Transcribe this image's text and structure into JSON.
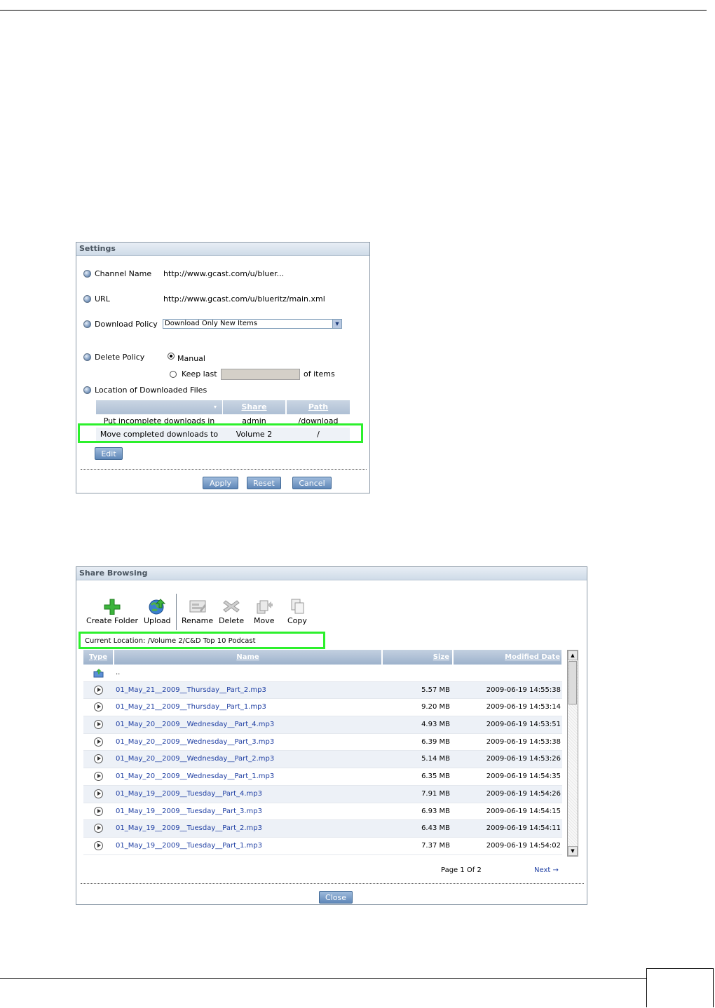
{
  "settings": {
    "title": "Settings",
    "channel_name_label": "Channel Name",
    "channel_name_value": "http://www.gcast.com/u/bluer...",
    "url_label": "URL",
    "url_value": "http://www.gcast.com/u/blueritz/main.xml",
    "download_policy_label": "Download Policy",
    "download_policy_value": "Download Only New Items",
    "delete_policy_label": "Delete Policy",
    "manual_label": "Manual",
    "keep_last_label": "Keep last",
    "of_items_label": "of items",
    "location_label": "Location of Downloaded Files",
    "table": {
      "headers": [
        "",
        "Share",
        "Path"
      ],
      "rows": [
        [
          "Put incomplete downloads in",
          "admin",
          "/download"
        ],
        [
          "Move completed downloads to",
          "Volume 2",
          "/"
        ]
      ]
    },
    "edit_label": "Edit",
    "apply_label": "Apply",
    "reset_label": "Reset",
    "cancel_label": "Cancel"
  },
  "share": {
    "title": "Share Browsing",
    "toolbar": {
      "create_folder": "Create Folder",
      "upload": "Upload",
      "rename": "Rename",
      "delete": "Delete",
      "move": "Move",
      "copy": "Copy"
    },
    "current_location": "Current Location: /Volume 2/C&D Top 10 Podcast",
    "headers": {
      "type": "Type",
      "name": "Name",
      "size": "Size",
      "modified": "Modified Date"
    },
    "parent_name": "..",
    "files": [
      {
        "name": "01_May_21__2009__Thursday__Part_2.mp3",
        "size": "5.57 MB",
        "date": "2009-06-19 14:55:38"
      },
      {
        "name": "01_May_21__2009__Thursday__Part_1.mp3",
        "size": "9.20 MB",
        "date": "2009-06-19 14:53:14"
      },
      {
        "name": "01_May_20__2009__Wednesday__Part_4.mp3",
        "size": "4.93 MB",
        "date": "2009-06-19 14:53:51"
      },
      {
        "name": "01_May_20__2009__Wednesday__Part_3.mp3",
        "size": "6.39 MB",
        "date": "2009-06-19 14:53:38"
      },
      {
        "name": "01_May_20__2009__Wednesday__Part_2.mp3",
        "size": "5.14 MB",
        "date": "2009-06-19 14:53:26"
      },
      {
        "name": "01_May_20__2009__Wednesday__Part_1.mp3",
        "size": "6.35 MB",
        "date": "2009-06-19 14:54:35"
      },
      {
        "name": "01_May_19__2009__Tuesday__Part_4.mp3",
        "size": "7.91 MB",
        "date": "2009-06-19 14:54:26"
      },
      {
        "name": "01_May_19__2009__Tuesday__Part_3.mp3",
        "size": "6.93 MB",
        "date": "2009-06-19 14:54:15"
      },
      {
        "name": "01_May_19__2009__Tuesday__Part_2.mp3",
        "size": "6.43 MB",
        "date": "2009-06-19 14:54:11"
      },
      {
        "name": "01_May_19__2009__Tuesday__Part_1.mp3",
        "size": "7.37 MB",
        "date": "2009-06-19 14:54:02"
      }
    ],
    "page_info": "Page 1 Of 2",
    "next_label": "Next →",
    "close_label": "Close"
  },
  "colors": {
    "highlight": "#2cf02c",
    "link": "#1f3fa3",
    "header": "#aebfd4"
  }
}
